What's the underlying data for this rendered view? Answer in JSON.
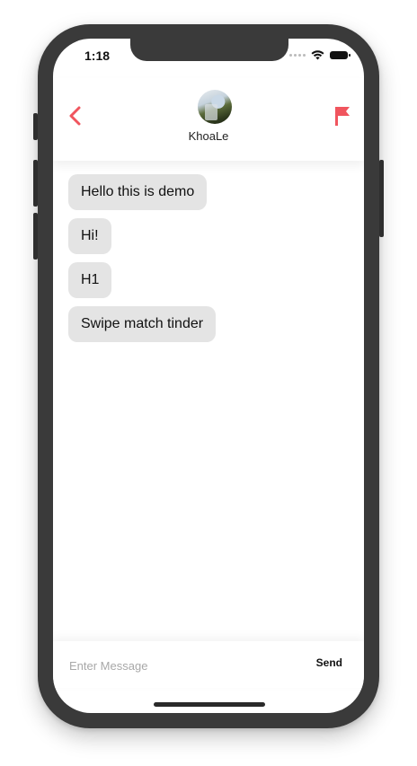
{
  "status_bar": {
    "time": "1:18",
    "icons": [
      "signal-dots-icon",
      "wifi-icon",
      "battery-icon"
    ]
  },
  "header": {
    "back_icon": "chevron-left-icon",
    "flag_icon": "flag-icon",
    "username": "KhoaLe",
    "accent_color": "#f0555e"
  },
  "messages": [
    {
      "text": "Hello this is demo"
    },
    {
      "text": "Hi!"
    },
    {
      "text": "H1"
    },
    {
      "text": "Swipe match tinder"
    }
  ],
  "composer": {
    "placeholder": "Enter Message",
    "value": "",
    "send_label": "Send"
  }
}
